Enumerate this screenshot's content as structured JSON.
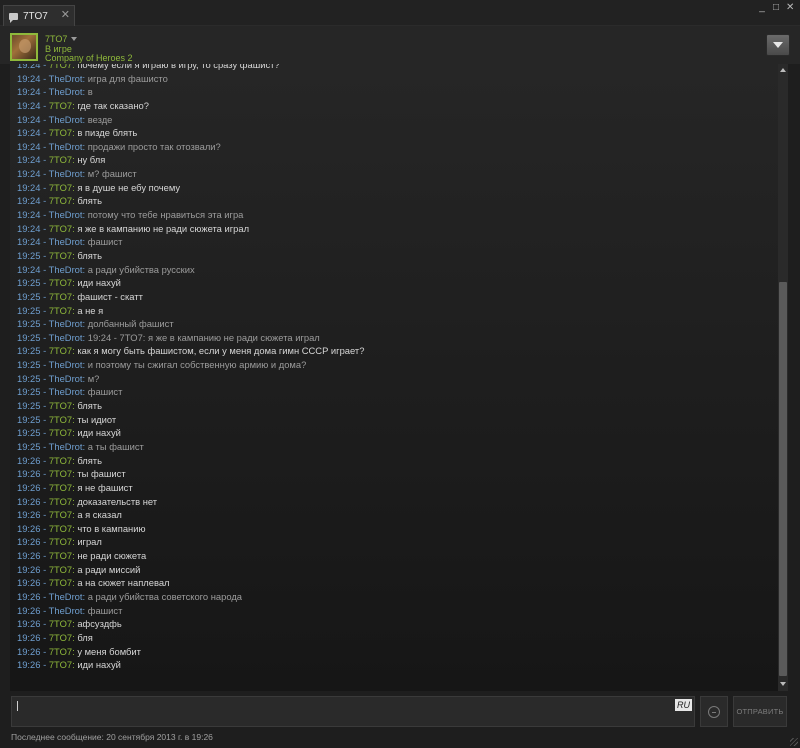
{
  "window": {
    "tab_label": "7TO7",
    "tab_close": "✕",
    "minimize": "_",
    "maximize": "□",
    "close": "✕"
  },
  "header": {
    "name": "7TO7",
    "status": "В игре",
    "game": "Company of Heroes 2"
  },
  "messages": [
    {
      "time": "19:24",
      "sender": "7TO7",
      "self": true,
      "text": "почему если я играю в игру, то сразу фашист?"
    },
    {
      "time": "19:24",
      "sender": "TheDrot",
      "self": false,
      "text": "игра для фашисто"
    },
    {
      "time": "19:24",
      "sender": "TheDrot",
      "self": false,
      "text": "в"
    },
    {
      "time": "19:24",
      "sender": "7TO7",
      "self": true,
      "text": "где так сказано?"
    },
    {
      "time": "19:24",
      "sender": "TheDrot",
      "self": false,
      "text": "везде"
    },
    {
      "time": "19:24",
      "sender": "7TO7",
      "self": true,
      "text": "в пизде блять"
    },
    {
      "time": "19:24",
      "sender": "TheDrot",
      "self": false,
      "text": "продажи просто так отозвали?"
    },
    {
      "time": "19:24",
      "sender": "7TO7",
      "self": true,
      "text": "ну бля"
    },
    {
      "time": "19:24",
      "sender": "TheDrot",
      "self": false,
      "text": "м? фашист"
    },
    {
      "time": "19:24",
      "sender": "7TO7",
      "self": true,
      "text": "я в душе не ебу почему"
    },
    {
      "time": "19:24",
      "sender": "7TO7",
      "self": true,
      "text": "блять"
    },
    {
      "time": "19:24",
      "sender": "TheDrot",
      "self": false,
      "text": "потому что тебе нравиться эта игра"
    },
    {
      "time": "19:24",
      "sender": "7TO7",
      "self": true,
      "text": "я же в кампанию не ради сюжета играл"
    },
    {
      "time": "19:24",
      "sender": "TheDrot",
      "self": false,
      "text": "фашист"
    },
    {
      "time": "19:25",
      "sender": "7TO7",
      "self": true,
      "text": "блять"
    },
    {
      "time": "19:24",
      "sender": "TheDrot",
      "self": false,
      "text": "а ради убийства русских"
    },
    {
      "time": "19:25",
      "sender": "7TO7",
      "self": true,
      "text": "иди нахуй"
    },
    {
      "time": "19:25",
      "sender": "7TO7",
      "self": true,
      "text": "фашист - скатт"
    },
    {
      "time": "19:25",
      "sender": "7TO7",
      "self": true,
      "text": "а не я"
    },
    {
      "time": "19:25",
      "sender": "TheDrot",
      "self": false,
      "text": "долбанный фашист"
    },
    {
      "time": "19:25",
      "sender": "TheDrot",
      "self": false,
      "text": "19:24 - 7TO7: я же в кампанию не ради сюжета играл"
    },
    {
      "time": "19:25",
      "sender": "7TO7",
      "self": true,
      "text": "как я могу быть фашистом, если у меня дома гимн СССР играет?"
    },
    {
      "time": "19:25",
      "sender": "TheDrot",
      "self": false,
      "text": "и поэтому ты сжигал собственную армию и дома?"
    },
    {
      "time": "19:25",
      "sender": "TheDrot",
      "self": false,
      "text": "м?"
    },
    {
      "time": "19:25",
      "sender": "TheDrot",
      "self": false,
      "text": "фашист"
    },
    {
      "time": "19:25",
      "sender": "7TO7",
      "self": true,
      "text": "блять"
    },
    {
      "time": "19:25",
      "sender": "7TO7",
      "self": true,
      "text": "ты идиот"
    },
    {
      "time": "19:25",
      "sender": "7TO7",
      "self": true,
      "text": "иди нахуй"
    },
    {
      "time": "19:25",
      "sender": "TheDrot",
      "self": false,
      "text": "а ты фашист"
    },
    {
      "time": "19:26",
      "sender": "7TO7",
      "self": true,
      "text": "блять"
    },
    {
      "time": "19:26",
      "sender": "7TO7",
      "self": true,
      "text": "ты фашист"
    },
    {
      "time": "19:26",
      "sender": "7TO7",
      "self": true,
      "text": "я не фашист"
    },
    {
      "time": "19:26",
      "sender": "7TO7",
      "self": true,
      "text": "доказательств нет"
    },
    {
      "time": "19:26",
      "sender": "7TO7",
      "self": true,
      "text": "а я сказал"
    },
    {
      "time": "19:26",
      "sender": "7TO7",
      "self": true,
      "text": "что в кампанию"
    },
    {
      "time": "19:26",
      "sender": "7TO7",
      "self": true,
      "text": "играл"
    },
    {
      "time": "19:26",
      "sender": "7TO7",
      "self": true,
      "text": "не ради сюжета"
    },
    {
      "time": "19:26",
      "sender": "7TO7",
      "self": true,
      "text": "а ради миссий"
    },
    {
      "time": "19:26",
      "sender": "7TO7",
      "self": true,
      "text": "а на сюжет наплевал"
    },
    {
      "time": "19:26",
      "sender": "TheDrot",
      "self": false,
      "text": "а ради убийства советского народа"
    },
    {
      "time": "19:26",
      "sender": "TheDrot",
      "self": false,
      "text": "фашист"
    },
    {
      "time": "19:26",
      "sender": "7TO7",
      "self": true,
      "text": "афсуздфь"
    },
    {
      "time": "19:26",
      "sender": "7TO7",
      "self": true,
      "text": "бля"
    },
    {
      "time": "19:26",
      "sender": "7TO7",
      "self": true,
      "text": "у меня бомбит"
    },
    {
      "time": "19:26",
      "sender": "7TO7",
      "self": true,
      "text": "иди нахуй"
    }
  ],
  "input": {
    "value": "",
    "lang": "RU"
  },
  "send_label": "ОТПРАВИТЬ",
  "footer": {
    "last_message": "Последнее сообщение: 20 сентября 2013 г. в 19:26"
  },
  "colors": {
    "self": "#8fb93b",
    "other": "#6f9fd0",
    "background": "#1e1e1e"
  },
  "icons": {
    "tab": "chat-bubble-icon",
    "menu": "chevron-down-icon",
    "emoji": "smiley-icon"
  }
}
